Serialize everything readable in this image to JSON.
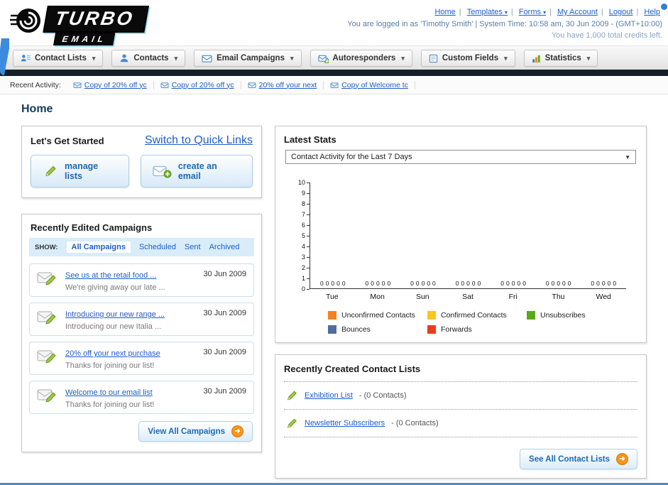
{
  "header": {
    "logo": {
      "title": "TURBO",
      "subtitle": "EMAIL"
    },
    "links": [
      {
        "label": "Home"
      },
      {
        "label": "Templates"
      },
      {
        "label": "Forms"
      },
      {
        "label": "My Account"
      },
      {
        "label": "Logout"
      },
      {
        "label": "Help"
      }
    ],
    "login_info": "You are logged in as 'Timothy Smith' | System Time: 10:58 am, 30 Jun 2009 - (GMT+10:00)",
    "credits_info": "You have 1,000 total credits left."
  },
  "nav_tabs": [
    {
      "label": "Contact Lists"
    },
    {
      "label": "Contacts"
    },
    {
      "label": "Email Campaigns"
    },
    {
      "label": "Autoresponders"
    },
    {
      "label": "Custom Fields"
    },
    {
      "label": "Statistics"
    }
  ],
  "recent_activity": {
    "label": "Recent Activity:",
    "items": [
      "Copy of 20% off yc",
      "Copy of 20% off yc",
      "20% off your next",
      "Copy of Welcome tc"
    ]
  },
  "page_title": "Home",
  "get_started": {
    "title": "Let's Get Started",
    "switch_link": "Switch to Quick Links",
    "buttons": [
      {
        "label": "manage lists"
      },
      {
        "label": "create an email"
      }
    ]
  },
  "campaigns": {
    "title": "Recently Edited Campaigns",
    "show_label": "SHOW:",
    "tabs": [
      "All Campaigns",
      "Scheduled",
      "Sent",
      "Archived"
    ],
    "items": [
      {
        "title": "See us at the retail food ...",
        "subtitle": "We're giving away our late ...",
        "date": "30 Jun 2009"
      },
      {
        "title": "Introducing our new range ...",
        "subtitle": "Introducing our new Italia ...",
        "date": "30 Jun 2009"
      },
      {
        "title": "20% off your next purchase",
        "subtitle": "Thanks for joining our list!",
        "date": "30 Jun 2009"
      },
      {
        "title": "Welcome to our email list",
        "subtitle": "Thanks for joining our list!",
        "date": "30 Jun 2009"
      }
    ],
    "view_all_label": "View All Campaigns"
  },
  "latest_stats": {
    "title": "Latest Stats",
    "dropdown_value": "Contact Activity for the Last 7 Days",
    "chart_data": {
      "type": "bar",
      "categories": [
        "Tue",
        "Mon",
        "Sun",
        "Sat",
        "Fri",
        "Thu",
        "Wed"
      ],
      "series": [
        {
          "name": "Unconfirmed Contacts",
          "color": "#f5821f",
          "values": [
            0,
            0,
            0,
            0,
            0,
            0,
            0
          ]
        },
        {
          "name": "Confirmed Contacts",
          "color": "#fdc51c",
          "values": [
            0,
            0,
            0,
            0,
            0,
            0,
            0
          ]
        },
        {
          "name": "Unsubscribes",
          "color": "#5aa917",
          "values": [
            0,
            0,
            0,
            0,
            0,
            0,
            0
          ]
        },
        {
          "name": "Bounces",
          "color": "#4f6e9e",
          "values": [
            0,
            0,
            0,
            0,
            0,
            0,
            0
          ]
        },
        {
          "name": "Forwards",
          "color": "#e73e1e",
          "values": [
            0,
            0,
            0,
            0,
            0,
            0,
            0
          ]
        }
      ],
      "y_ticks": [
        10,
        9,
        8,
        7,
        6,
        5,
        4,
        3,
        2,
        1,
        0
      ],
      "ylim": [
        0,
        10
      ],
      "title": "Contact Activity for the Last 7 Days",
      "xlabel": "",
      "ylabel": "",
      "grid": false,
      "legend_position": "bottom"
    }
  },
  "contact_lists": {
    "title": "Recently Created Contact Lists",
    "items": [
      {
        "name": "Exhibition List",
        "count": "- (0 Contacts)"
      },
      {
        "name": "Newsletter Subscribers",
        "count": "- (0 Contacts)"
      }
    ],
    "see_all_label": "See All Contact Lists"
  }
}
